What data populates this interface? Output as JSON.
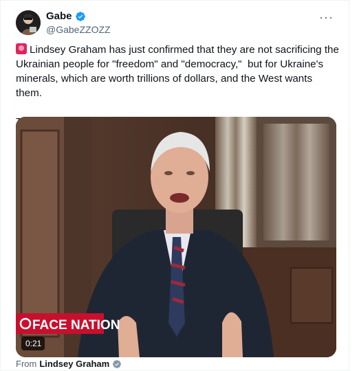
{
  "author": {
    "name": "Gabe",
    "handle": "@GabeZZOZZ"
  },
  "tweet": {
    "text": "Lindsey Graham has just confirmed that they are not sacrificing the Ukrainian people for \"freedom\" and \"democracy,\"  but for Ukraine's minerals, which are worth trillions of dollars, and the West wants them.\n\nThis is unbelievable..."
  },
  "video": {
    "duration": "0:21",
    "overlay_brand_left": "FACE",
    "overlay_brand_right": "NATION"
  },
  "attribution": {
    "prefix": "From",
    "source": "Lindsey Graham"
  },
  "icons": {
    "more": "more-horizontal-icon",
    "verified": "verified-badge-icon",
    "siren": "rotating-light-icon"
  },
  "colors": {
    "verified": "#1d9bf0",
    "secondary_text": "#536471",
    "overlay_red": "#c8102e"
  }
}
